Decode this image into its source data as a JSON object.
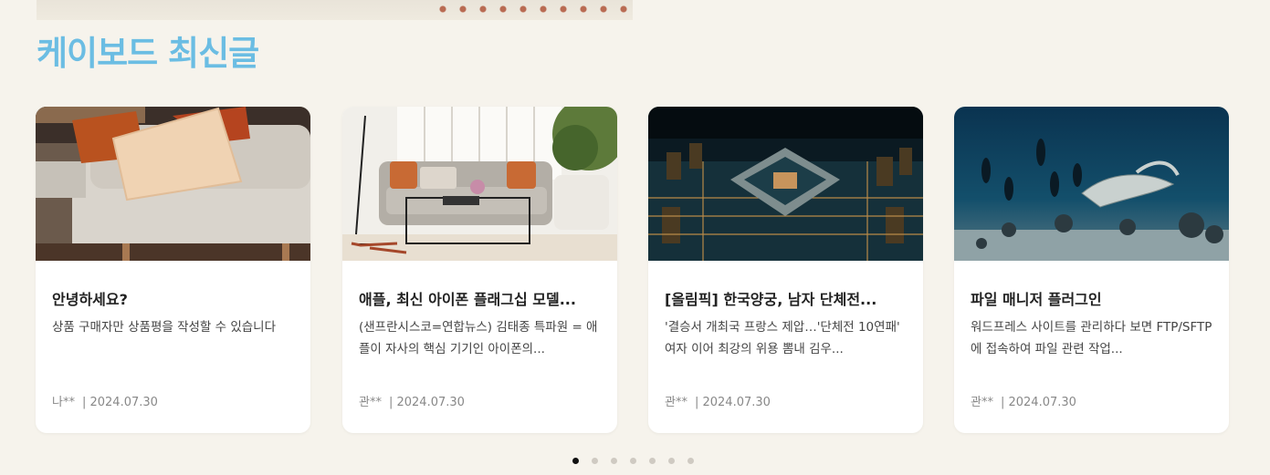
{
  "section": {
    "title": "케이보드 최신글"
  },
  "posts": [
    {
      "title": "안녕하세요?",
      "excerpt": "상품 구매자만 상품평을 작성할 수 있습니다",
      "author": "나**",
      "date": "| 2024.07.30",
      "image": "sofa-cushions-photo"
    },
    {
      "title": "애플, 최신 아이폰 플래그십 모델...",
      "excerpt": "(샌프란시스코=연합뉴스) 김태종 특파원 = 애플이 자사의 핵심 기기인 아이폰의...",
      "author": "관**",
      "date": "| 2024.07.30",
      "image": "living-room-photo"
    },
    {
      "title": "[올림픽] 한국양궁, 남자 단체전...",
      "excerpt": "'결승서 개최국 프랑스 제압…'단체전 10연패' 여자 이어 최강의 위용 뽐내 김우...",
      "author": "관**",
      "date": "| 2024.07.30",
      "image": "circuit-chip-photo"
    },
    {
      "title": "파일 매니저 플러그인",
      "excerpt": "워드프레스 사이트를 관리하다 보면 FTP/SFTP에 접속하여 파일 관련 작업...",
      "author": "관**",
      "date": "| 2024.07.30",
      "image": "underwater-divers-photo"
    }
  ],
  "pagination": {
    "total": 7,
    "active": 1
  },
  "colors": {
    "accent": "#6bbde3",
    "background": "#f6f3ec"
  }
}
